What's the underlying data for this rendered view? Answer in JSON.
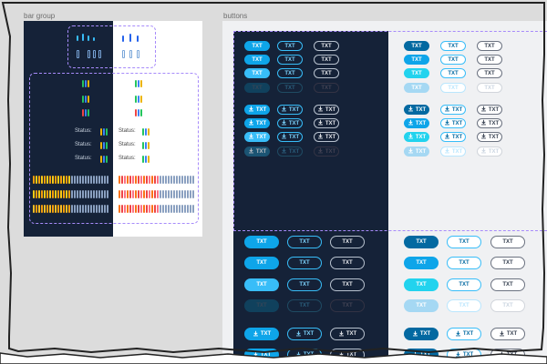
{
  "frames": {
    "bar_group": {
      "label": "bar group"
    },
    "buttons": {
      "label": "buttons"
    }
  },
  "bar_group": {
    "status_label": "Status:"
  },
  "buttons": {
    "label": "TXT",
    "icon": "download-icon"
  },
  "colors": {
    "dark_bg": "#152238",
    "light_bg": "#f0f1f3",
    "primary": "#0ea5e9",
    "accent_cyan": "#22d3ee",
    "dashed": "#a78bfa"
  }
}
